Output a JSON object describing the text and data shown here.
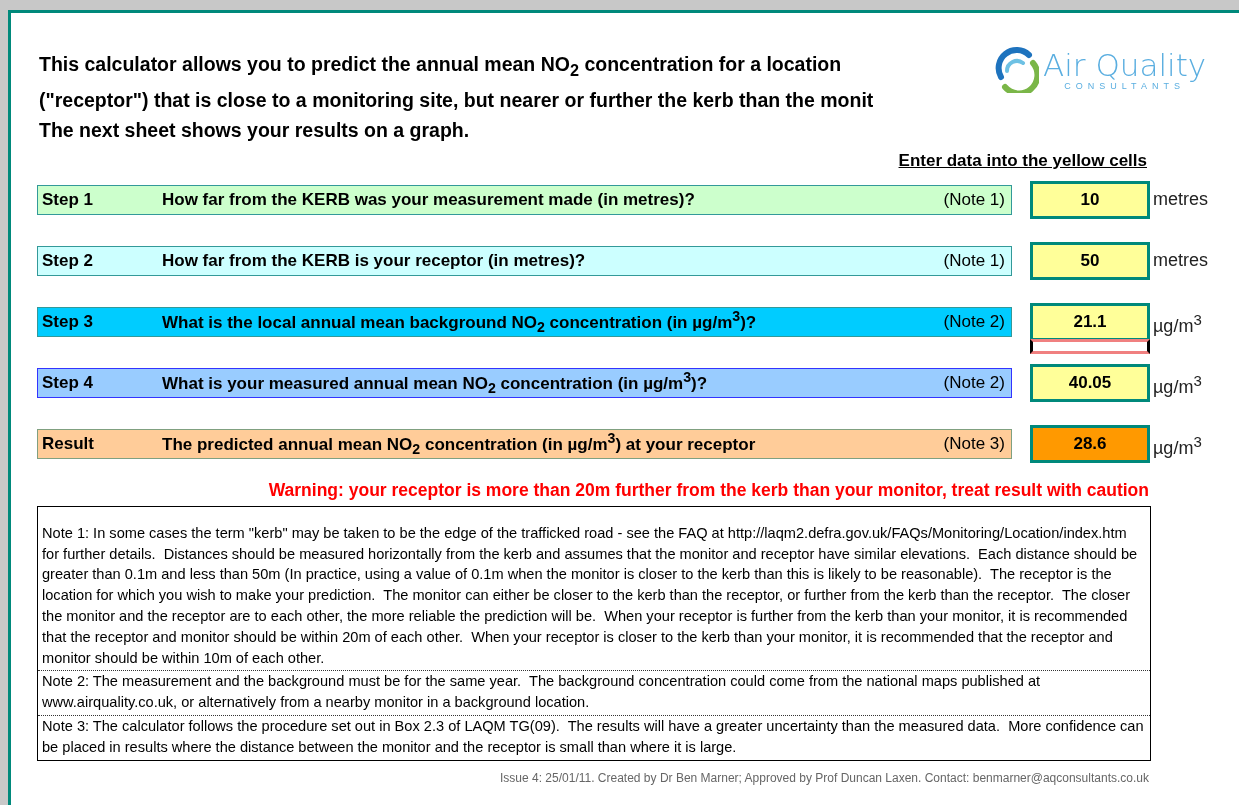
{
  "intro": [
    "This calculator allows you to predict the annual mean NO$_{2}$ concentration for a location",
    "(\"receptor\") that is close to a monitoring site, but nearer or further the kerb than the monit",
    "The next sheet shows your results on a graph."
  ],
  "logo": {
    "name": "Air Quality",
    "tagline": "CONSULTANTS"
  },
  "instruction": "Enter data into the yellow cells",
  "steps": [
    {
      "kind": "input",
      "label": "Step 1",
      "question": "How far from the KERB was your measurement made (in metres)?",
      "note": "(Note 1)",
      "value": "10",
      "unit": "metres",
      "color": "#ccffcc",
      "selection_below": false
    },
    {
      "kind": "input",
      "label": "Step 2",
      "question": "How far from the KERB is your receptor (in metres)?",
      "note": "(Note 1)",
      "value": "50",
      "unit": "metres",
      "color": "#ccffff",
      "selection_below": false
    },
    {
      "kind": "input",
      "label": "Step 3",
      "question": "What is the local annual mean background NO$_{2}$ concentration (in µg/m$^{3}$)?",
      "note": "(Note 2)",
      "value": "21.1",
      "unit": "µg/m$^{3}$",
      "color": "#00ccff",
      "selection_below": true
    },
    {
      "kind": "input",
      "label": "Step 4",
      "question": "What is your measured annual mean NO$_{2}$ concentration (in µg/m$^{3}$)?",
      "note": "(Note 2)",
      "value": "40.05",
      "unit": "µg/m$^{3}$",
      "color": "#99ccff",
      "selection_below": false
    },
    {
      "kind": "result",
      "label": "Result",
      "question": "The predicted annual mean NO$_{2}$ concentration (in µg/m$^{3}$) at your receptor",
      "note": "(Note 3)",
      "value": "28.6",
      "unit": "µg/m$^{3}$",
      "color": "#ffcc99",
      "selection_below": false
    }
  ],
  "warning": "Warning: your receptor is more than 20m further from the kerb than your monitor, treat result with caution",
  "notes": [
    "Note 1: In some cases the term \"kerb\" may be taken to be the edge of the trafficked road - see the FAQ at http://laqm2.defra.gov.uk/FAQs/Monitoring/Location/index.htm for further details.  Distances should be measured horizontally from the kerb and assumes that the monitor and receptor have similar elevations.  Each distance should be greater than 0.1m and less than 50m (In practice, using a value of 0.1m when the monitor is closer to the kerb than this is likely to be reasonable).  The receptor is the location for which you wish to make your prediction.  The monitor can either be closer to the kerb than the receptor, or further from the kerb than the receptor.  The closer the monitor and the receptor are to each other, the more reliable the prediction will be.  When your receptor is further from the kerb than your monitor, it is recommended that the receptor and monitor should be within 20m of each other.  When your receptor is closer to the kerb than your monitor, it is recommended that the receptor and monitor should be within 10m of each other.",
    "Note 2: The measurement and the background must be for the same year.  The background concentration could come from the national maps published at www.airquality.co.uk, or alternatively from a nearby monitor in a background location.",
    "Note 3: The calculator follows the procedure set out in Box 2.3 of LAQM TG(09).  The results will have a greater uncertainty than the measured data.  More confidence can be placed in results where the distance between the monitor and the receptor is small than where it is large."
  ],
  "footer": "Issue 4: 25/01/11. Created by Dr Ben Marner; Approved by Prof Duncan Laxen. Contact: benmarner@aqconsultants.co.uk"
}
